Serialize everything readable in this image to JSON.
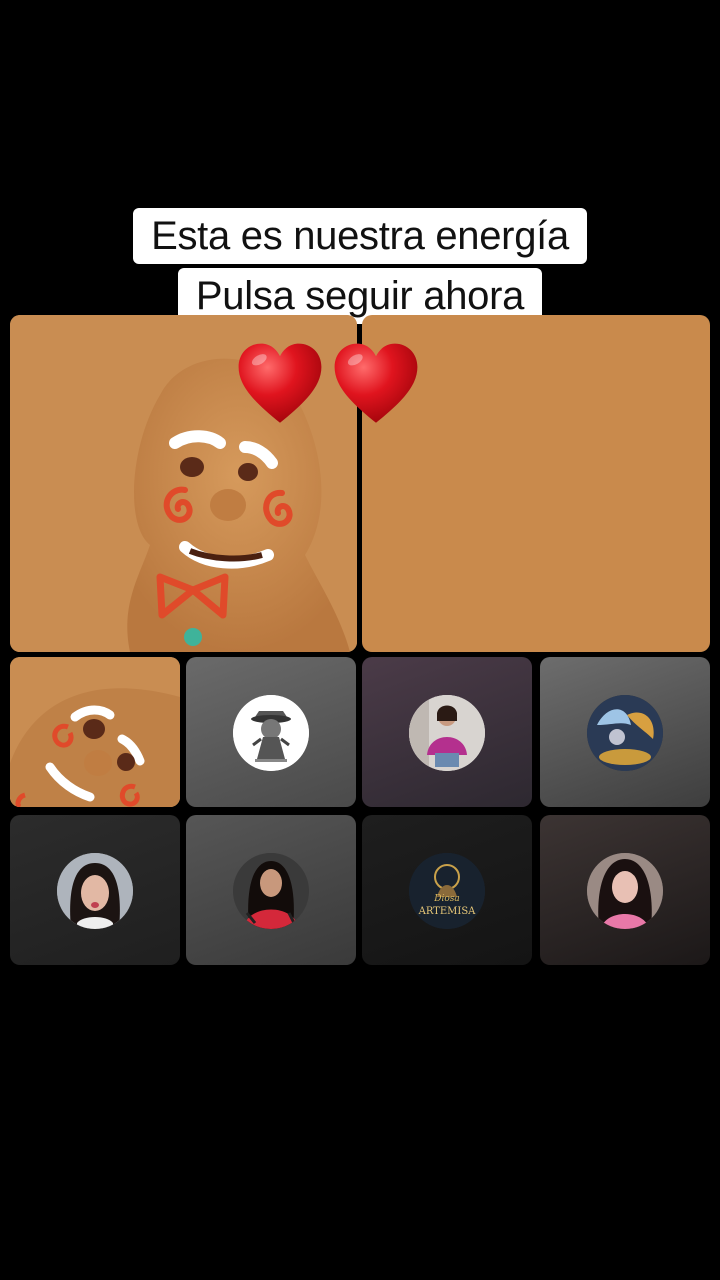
{
  "caption": {
    "line1": "Esta es nuestra energía",
    "line2": "Pulsa seguir ahora"
  },
  "icons": {
    "hearts": [
      "heart-icon",
      "heart-icon"
    ],
    "heart_color": "#e0141e"
  },
  "grid": {
    "featured_tiles": [
      {
        "name": "gingerbread-video-tile",
        "bg": "#c98d52"
      },
      {
        "name": "empty-video-tile",
        "bg": "#c98a4c"
      }
    ],
    "participants_row1": [
      {
        "name": "gingerbread-closeup-tile"
      },
      {
        "name": "participant-cat-warrior-avatar"
      },
      {
        "name": "participant-woman-pink-shawl-avatar"
      },
      {
        "name": "participant-fantasy-art-avatar"
      }
    ],
    "participants_row2": [
      {
        "name": "participant-woman-selfie-avatar"
      },
      {
        "name": "participant-woman-red-top-avatar"
      },
      {
        "name": "participant-diosa-artemisa-avatar",
        "logo_text": "Diosa ARTEMISA"
      },
      {
        "name": "participant-woman-pink-avatar"
      }
    ]
  },
  "colors": {
    "background": "#000000",
    "tile_orange": "#c98d52"
  }
}
